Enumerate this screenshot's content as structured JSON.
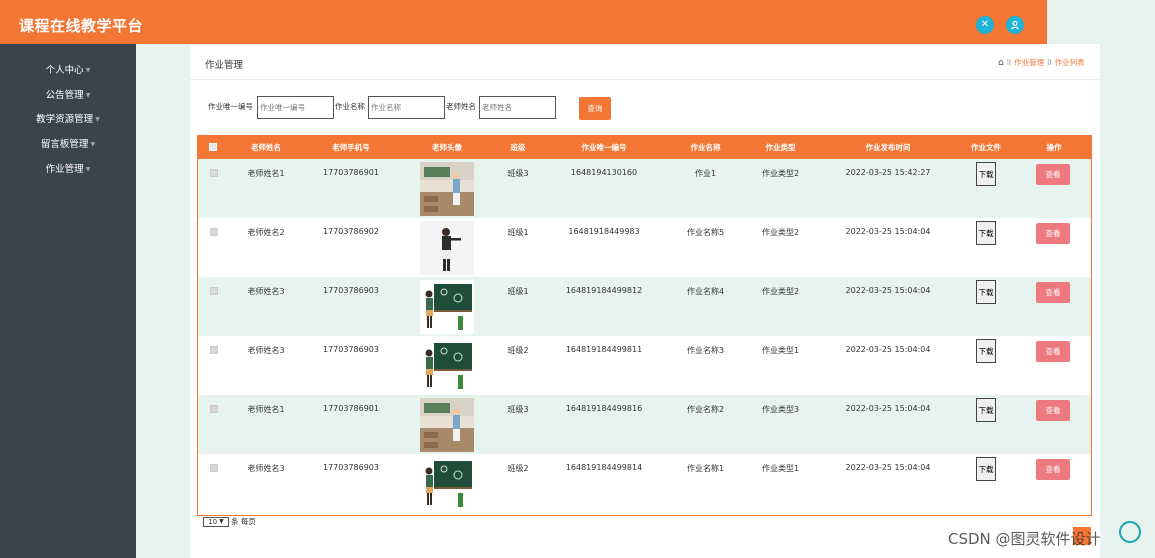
{
  "header": {
    "app_title": "课程在线教学平台",
    "icon_left": "crosshair-icon",
    "icon_right": "user-icon",
    "accent_color": "#f47634"
  },
  "sidebar": {
    "items": [
      {
        "label": "个人中心"
      },
      {
        "label": "公告管理"
      },
      {
        "label": "教学资源管理"
      },
      {
        "label": "留言板管理"
      },
      {
        "label": "作业管理"
      }
    ]
  },
  "panel": {
    "title": "作业管理",
    "breadcrumb": {
      "sep": "II",
      "item1": "作业管理",
      "item2": "作业列表"
    }
  },
  "search": {
    "label_id": "作业唯一编号",
    "placeholder_id": "作业唯一编号",
    "label_name": "作业名称",
    "placeholder_name": "作业名称",
    "label_teacher": "老师姓名",
    "placeholder_teacher": "老师姓名",
    "button": "查询"
  },
  "table": {
    "headers": {
      "teacher": "老师姓名",
      "phone": "老师手机号",
      "avatar": "老师头像",
      "class": "班级",
      "id": "作业唯一编号",
      "name": "作业名称",
      "type": "作业类型",
      "time": "作业发布时间",
      "file": "作业文件",
      "action": "操作"
    },
    "download_label": "下载",
    "view_label": "查看",
    "rows": [
      {
        "teacher": "老师姓名1",
        "phone": "17703786901",
        "avatar": "classroom",
        "class": "班级3",
        "id": "1648194130160",
        "name": "作业1",
        "type": "作业类型2",
        "time": "2022-03-25 15:42:27"
      },
      {
        "teacher": "老师姓名2",
        "phone": "17703786902",
        "avatar": "presenter",
        "class": "班级1",
        "id": "16481918449983",
        "name": "作业名称5",
        "type": "作业类型2",
        "time": "2022-03-25 15:04:04"
      },
      {
        "teacher": "老师姓名3",
        "phone": "17703786903",
        "avatar": "chalkboard",
        "class": "班级1",
        "id": "164819184499812",
        "name": "作业名称4",
        "type": "作业类型2",
        "time": "2022-03-25 15:04:04"
      },
      {
        "teacher": "老师姓名3",
        "phone": "17703786903",
        "avatar": "chalkboard",
        "class": "班级2",
        "id": "164819184499811",
        "name": "作业名称3",
        "type": "作业类型1",
        "time": "2022-03-25 15:04:04"
      },
      {
        "teacher": "老师姓名1",
        "phone": "17703786901",
        "avatar": "classroom",
        "class": "班级3",
        "id": "164819184499816",
        "name": "作业名称2",
        "type": "作业类型3",
        "time": "2022-03-25 15:04:04"
      },
      {
        "teacher": "老师姓名3",
        "phone": "17703786903",
        "avatar": "chalkboard",
        "class": "班级2",
        "id": "164819184499814",
        "name": "作业名称1",
        "type": "作业类型1",
        "time": "2022-03-25 15:04:04"
      }
    ]
  },
  "pager": {
    "page_size": "10",
    "suffix": "条 每页"
  },
  "watermark": "CSDN @图灵软件设计"
}
